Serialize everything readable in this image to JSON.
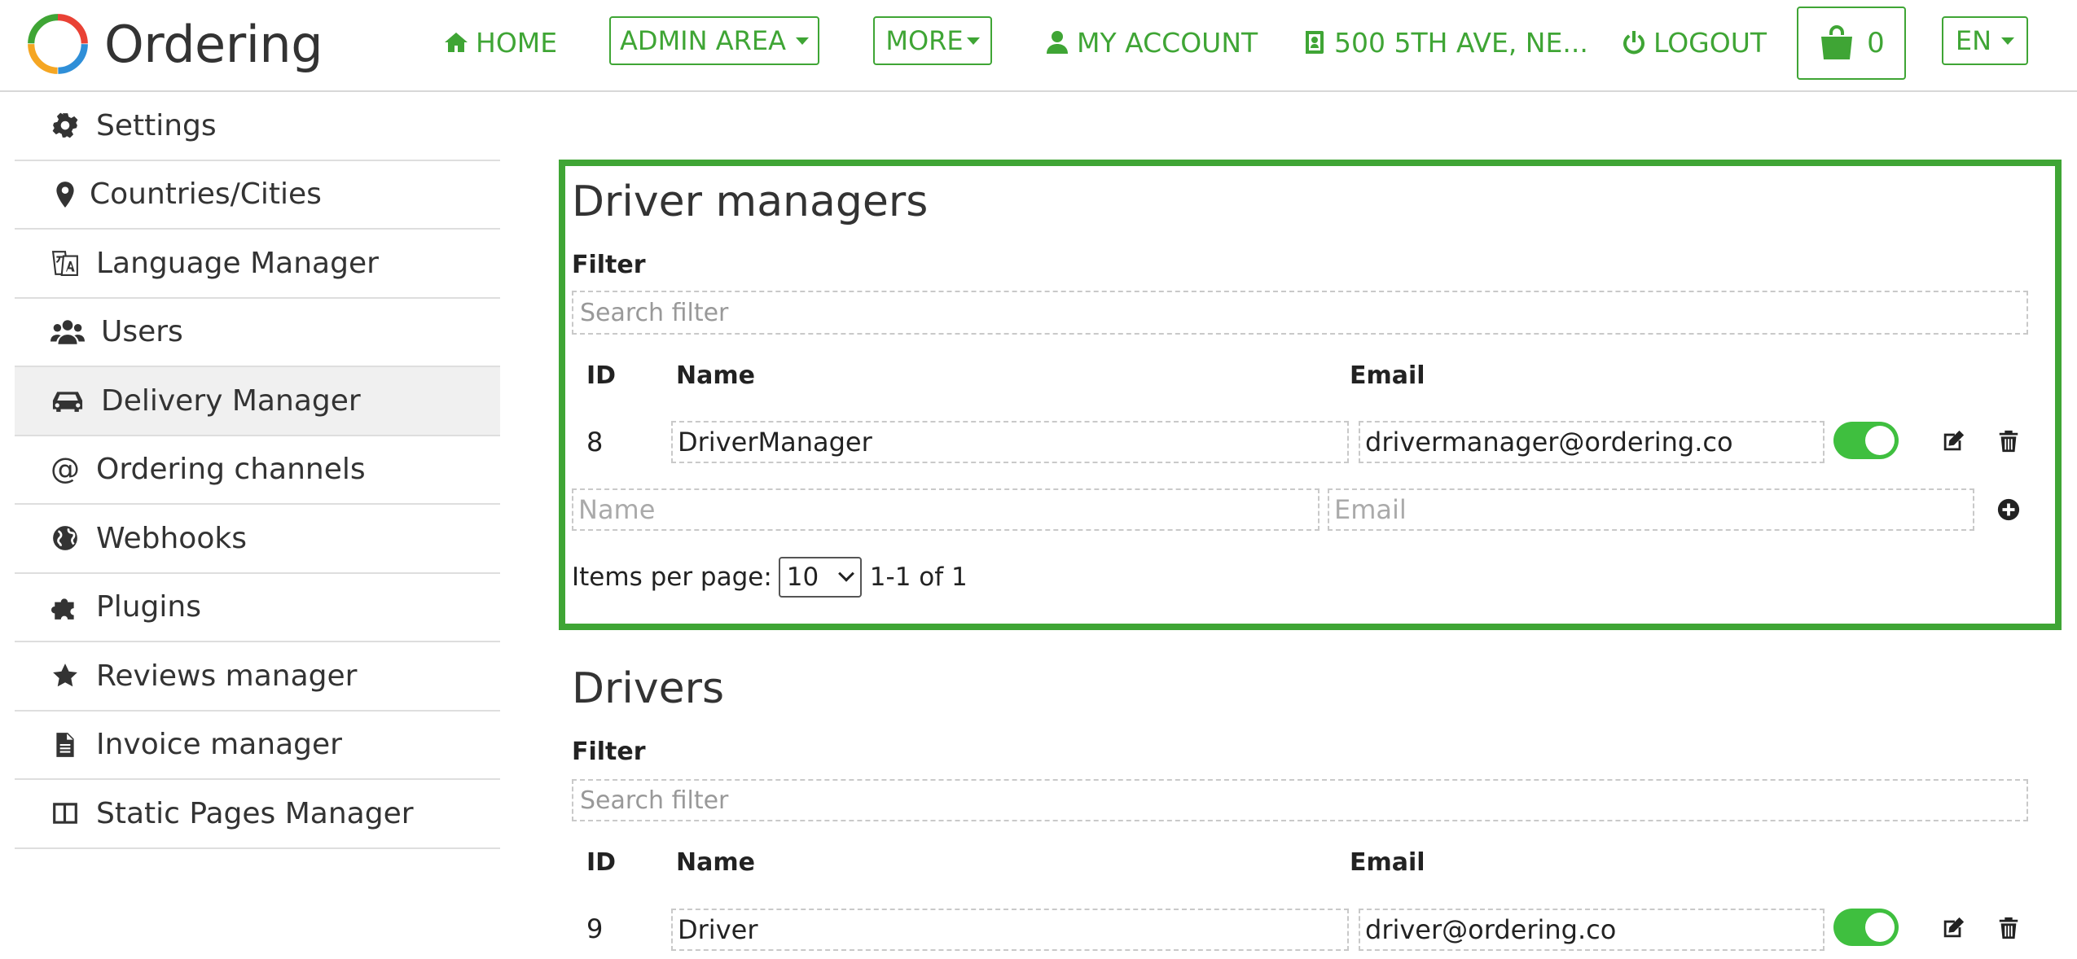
{
  "header": {
    "brand": "Ordering",
    "nav": {
      "home": "HOME",
      "admin_area": "ADMIN AREA",
      "more": "MORE",
      "my_account": "MY ACCOUNT",
      "address": "500 5TH AVE, NE...",
      "logout": "LOGOUT",
      "cart_count": "0",
      "language": "EN"
    },
    "accent_color": "#3fa535"
  },
  "sidebar": {
    "items": [
      {
        "label": "Settings",
        "icon": "gear-icon"
      },
      {
        "label": "Countries/Cities",
        "icon": "map-marker-icon"
      },
      {
        "label": "Language Manager",
        "icon": "translate-icon"
      },
      {
        "label": "Users",
        "icon": "users-icon"
      },
      {
        "label": "Delivery Manager",
        "icon": "car-icon",
        "active": true
      },
      {
        "label": "Ordering channels",
        "icon": "at-icon"
      },
      {
        "label": "Webhooks",
        "icon": "globe-icon"
      },
      {
        "label": "Plugins",
        "icon": "puzzle-icon"
      },
      {
        "label": "Reviews manager",
        "icon": "star-icon"
      },
      {
        "label": "Invoice manager",
        "icon": "file-icon"
      },
      {
        "label": "Static Pages Manager",
        "icon": "columns-icon"
      }
    ]
  },
  "driver_managers": {
    "title": "Driver managers",
    "filter_label": "Filter",
    "search_placeholder": "Search filter",
    "columns": {
      "id": "ID",
      "name": "Name",
      "email": "Email"
    },
    "rows": [
      {
        "id": "8",
        "name": "DriverManager",
        "email": "drivermanager@ordering.co",
        "enabled": true
      }
    ],
    "new_row": {
      "name_placeholder": "Name",
      "email_placeholder": "Email"
    },
    "pagination": {
      "label": "Items per page:",
      "per_page": "10",
      "range": "1-1 of 1"
    }
  },
  "drivers": {
    "title": "Drivers",
    "filter_label": "Filter",
    "search_placeholder": "Search filter",
    "columns": {
      "id": "ID",
      "name": "Name",
      "email": "Email"
    },
    "rows": [
      {
        "id": "9",
        "name": "Driver",
        "email": "driver@ordering.co",
        "enabled": true
      }
    ]
  }
}
